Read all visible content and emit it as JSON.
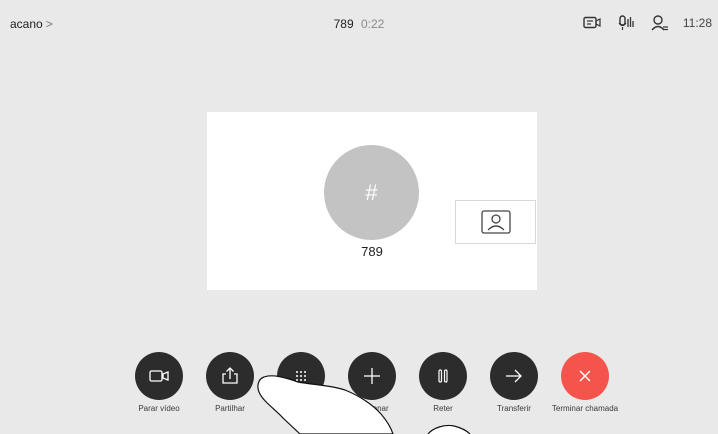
{
  "topbar": {
    "site": "acano",
    "site_chevron": ">",
    "call_number": "789",
    "call_duration": "0:22",
    "clock": "11:28",
    "status_icons": [
      "screen-share-icon",
      "mic-level-icon",
      "participant-icon"
    ]
  },
  "call": {
    "avatar_symbol": "#",
    "name": "789",
    "selfview_icon": "person-frame-icon"
  },
  "controls": [
    {
      "label": "Parar vídeo",
      "icon": "video-camera-icon"
    },
    {
      "label": "Partilhar",
      "icon": "share-icon"
    },
    {
      "label": "",
      "icon": "keypad-icon"
    },
    {
      "label": "Adicionar",
      "icon": "plus-icon"
    },
    {
      "label": "Reter",
      "icon": "pause-icon"
    },
    {
      "label": "Transferir",
      "icon": "arrow-right-icon"
    },
    {
      "label": "Terminar chamada",
      "icon": "close-icon"
    }
  ],
  "colors": {
    "background": "#e9e9e9",
    "control_button": "#2c2c2c",
    "end_call": "#f4544b",
    "avatar": "#c3c3c3"
  }
}
